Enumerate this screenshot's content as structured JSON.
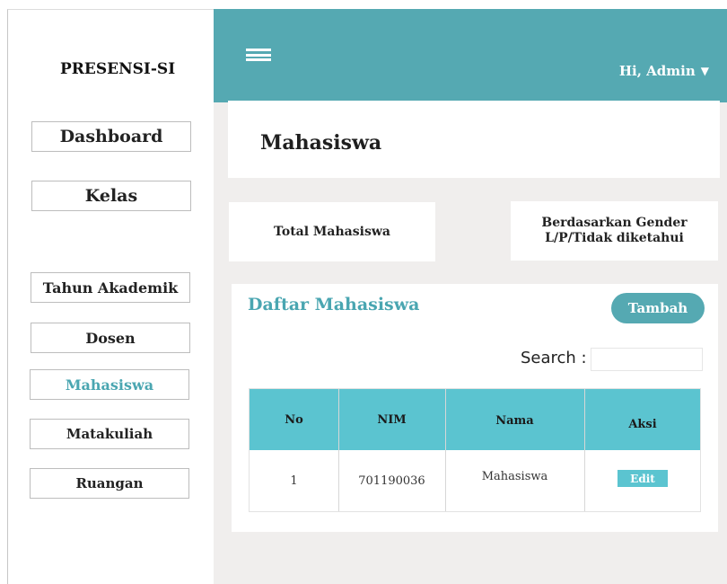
{
  "app": {
    "brand": "PRESENSI-SI"
  },
  "sidebar": {
    "items": [
      {
        "label": "Dashboard"
      },
      {
        "label": "Kelas"
      },
      {
        "label": "Tahun Akademik"
      },
      {
        "label": "Dosen"
      },
      {
        "label": "Mahasiswa",
        "active": true
      },
      {
        "label": "Matakuliah"
      },
      {
        "label": "Ruangan"
      }
    ]
  },
  "header": {
    "user_greeting": "Hi, Admin",
    "caret": "▼",
    "menu_icon": "hamburger-icon"
  },
  "page": {
    "title": "Mahasiswa"
  },
  "stats": [
    {
      "label": "Total Mahasiswa"
    },
    {
      "line1": "Berdasarkan Gender",
      "line2": "L/P/Tidak diketahui"
    }
  ],
  "list": {
    "title": "Daftar Mahasiswa",
    "add_label": "Tambah",
    "search_label": "Search :",
    "search_value": "",
    "columns": [
      "No",
      "NIM",
      "Nama",
      "Aksi"
    ],
    "rows": [
      {
        "no": "1",
        "nim": "701190036",
        "nama": "Mahasiswa",
        "action": "Edit"
      }
    ]
  },
  "colors": {
    "accent": "#55a9b2",
    "table_header": "#5bc4d0",
    "active_nav": "#4aa6b1",
    "background": "#f0eeed"
  }
}
